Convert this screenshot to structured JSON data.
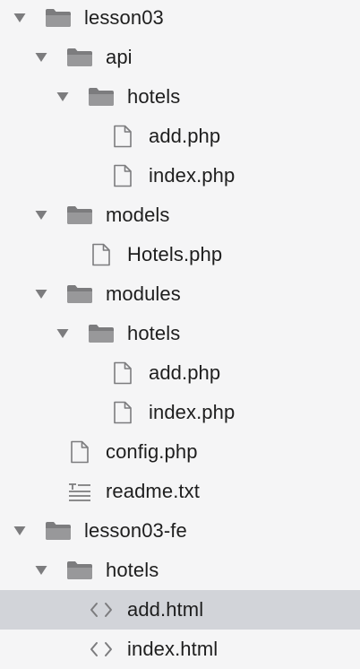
{
  "file_tree": {
    "items": [
      {
        "label": "lesson03",
        "kind": "folder",
        "level": 0,
        "expanded": true,
        "icon": "folder-icon"
      },
      {
        "label": "api",
        "kind": "folder",
        "level": 1,
        "expanded": true,
        "icon": "folder-icon"
      },
      {
        "label": "hotels",
        "kind": "folder",
        "level": 2,
        "expanded": true,
        "icon": "folder-icon"
      },
      {
        "label": "add.php",
        "kind": "file",
        "level": 3,
        "icon": "file-icon"
      },
      {
        "label": "index.php",
        "kind": "file",
        "level": 3,
        "icon": "file-icon"
      },
      {
        "label": "models",
        "kind": "folder",
        "level": 1,
        "expanded": true,
        "icon": "folder-icon"
      },
      {
        "label": "Hotels.php",
        "kind": "file",
        "level": 2,
        "icon": "file-icon"
      },
      {
        "label": "modules",
        "kind": "folder",
        "level": 1,
        "expanded": true,
        "icon": "folder-icon"
      },
      {
        "label": "hotels",
        "kind": "folder",
        "level": 2,
        "expanded": true,
        "icon": "folder-icon"
      },
      {
        "label": "add.php",
        "kind": "file",
        "level": 3,
        "icon": "file-icon"
      },
      {
        "label": "index.php",
        "kind": "file",
        "level": 3,
        "icon": "file-icon"
      },
      {
        "label": "config.php",
        "kind": "file",
        "level": 1,
        "icon": "file-icon"
      },
      {
        "label": "readme.txt",
        "kind": "text",
        "level": 1,
        "icon": "text-file-icon"
      },
      {
        "label": "lesson03-fe",
        "kind": "folder",
        "level": 0,
        "expanded": true,
        "icon": "folder-icon"
      },
      {
        "label": "hotels",
        "kind": "folder",
        "level": 1,
        "expanded": true,
        "icon": "folder-icon"
      },
      {
        "label": "add.html",
        "kind": "code",
        "level": 2,
        "selected": true,
        "icon": "code-icon"
      },
      {
        "label": "index.html",
        "kind": "code",
        "level": 2,
        "icon": "code-icon"
      }
    ]
  },
  "colors": {
    "background": "#f5f5f6",
    "selected_row": "#d2d4d9",
    "icon_gray": "#7c7c7e",
    "text": "#1e1e1e"
  }
}
